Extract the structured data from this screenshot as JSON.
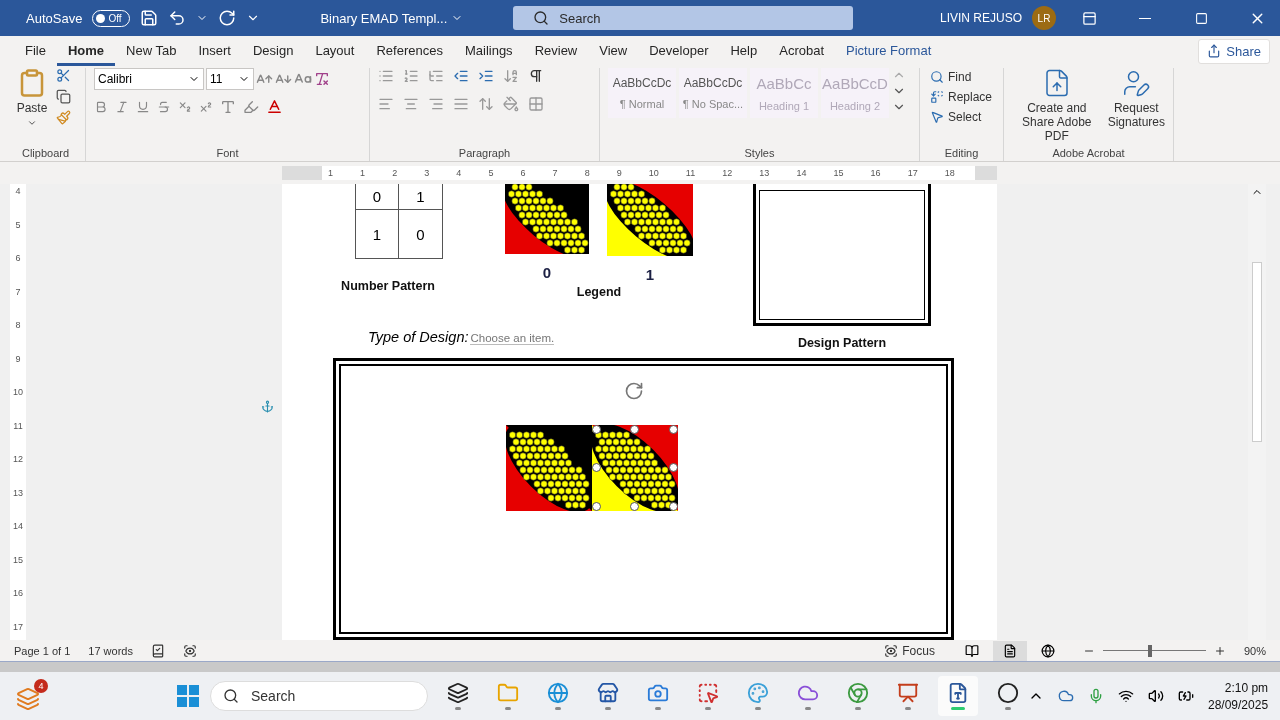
{
  "titlebar": {
    "autosave_label": "AutoSave",
    "autosave_state": "Off",
    "autosave_on": false,
    "document": "Binary EMAD Templ...",
    "search_placeholder": "Search",
    "user": "LIVIN REJUSO",
    "initials": "LR"
  },
  "menu_tabs": [
    {
      "label": "File",
      "selected": false,
      "kind": "normal"
    },
    {
      "label": "Home",
      "selected": true,
      "kind": "normal"
    },
    {
      "label": "New Tab",
      "selected": false,
      "kind": "normal"
    },
    {
      "label": "Insert",
      "selected": false,
      "kind": "normal"
    },
    {
      "label": "Design",
      "selected": false,
      "kind": "normal"
    },
    {
      "label": "Layout",
      "selected": false,
      "kind": "normal"
    },
    {
      "label": "References",
      "selected": false,
      "kind": "normal"
    },
    {
      "label": "Mailings",
      "selected": false,
      "kind": "normal"
    },
    {
      "label": "Review",
      "selected": false,
      "kind": "normal"
    },
    {
      "label": "View",
      "selected": false,
      "kind": "normal"
    },
    {
      "label": "Developer",
      "selected": false,
      "kind": "normal"
    },
    {
      "label": "Help",
      "selected": false,
      "kind": "normal"
    },
    {
      "label": "Acrobat",
      "selected": false,
      "kind": "normal"
    },
    {
      "label": "Picture Format",
      "selected": false,
      "kind": "contextual"
    }
  ],
  "share": "Share",
  "ribbon": {
    "paste": "Paste",
    "font_name": "Calibri",
    "font_size": "11",
    "styles": [
      {
        "sample": "AaBbCcDc",
        "label": "¶ Normal",
        "kind": "body"
      },
      {
        "sample": "AaBbCcDc",
        "label": "¶ No Spac...",
        "kind": "body"
      },
      {
        "sample": "AaBbCc",
        "label": "Heading 1",
        "kind": "heading"
      },
      {
        "sample": "AaBbCcD",
        "label": "Heading 2",
        "kind": "heading"
      }
    ],
    "editing": [
      {
        "label": "Find",
        "kind": "find"
      },
      {
        "label": "Replace",
        "kind": "replace"
      },
      {
        "label": "Select",
        "kind": "select"
      }
    ],
    "acrobat": [
      {
        "label": "Create and Share Adobe PDF",
        "kind": "pdf"
      },
      {
        "label": "Request Signatures",
        "kind": "sign"
      }
    ],
    "groups": [
      "Clipboard",
      "Font",
      "Paragraph",
      "Styles",
      "Editing",
      "Adobe Acrobat"
    ]
  },
  "ruler": {
    "horizontal": [
      "1",
      "1",
      "2",
      "3",
      "4",
      "5",
      "6",
      "7",
      "8",
      "9",
      "10",
      "11",
      "12",
      "13",
      "14",
      "15",
      "16",
      "17",
      "18"
    ],
    "vertical": [
      "4",
      "5",
      "6",
      "7",
      "8",
      "9",
      "10",
      "11",
      "12",
      "13",
      "14",
      "15",
      "16",
      "17"
    ]
  },
  "document": {
    "number_pattern": {
      "rows": [
        [
          "0",
          "1"
        ],
        [
          "1",
          "0"
        ]
      ],
      "label": "Number Pattern"
    },
    "legend": {
      "tiles": [
        {
          "kind": "zero",
          "label": "0"
        },
        {
          "kind": "one",
          "label": "1"
        }
      ],
      "label": "Legend"
    },
    "type_of_design": {
      "label": "Type of Design:",
      "placeholder": "Choose an item."
    },
    "design_pattern": {
      "label": "Design Pattern"
    },
    "canvas_tiles": [
      {
        "kind": "zero",
        "selected": false
      },
      {
        "kind": "one",
        "selected": true
      }
    ]
  },
  "status_bar": {
    "page": "Page 1 of 1",
    "words": "17 words",
    "focus": "Focus",
    "views": [
      {
        "kind": "read",
        "selected": false
      },
      {
        "kind": "print",
        "selected": true
      },
      {
        "kind": "web",
        "selected": false
      }
    ],
    "zoom_slider": {
      "level": 0.46
    },
    "zoom": "90%"
  },
  "taskbar": {
    "widget_badge": "4",
    "search_placeholder": "Search",
    "apps": [
      {
        "kind": "taskview",
        "selected": false
      },
      {
        "kind": "files",
        "selected": false
      },
      {
        "kind": "edge",
        "selected": false
      },
      {
        "kind": "store",
        "selected": false
      },
      {
        "kind": "camera",
        "selected": false
      },
      {
        "kind": "snip",
        "selected": false
      },
      {
        "kind": "paint",
        "selected": false
      },
      {
        "kind": "m365",
        "selected": false
      },
      {
        "kind": "chrome",
        "selected": false
      },
      {
        "kind": "powerpoint",
        "selected": false
      },
      {
        "kind": "word",
        "selected": true
      },
      {
        "kind": "obs",
        "selected": false
      }
    ],
    "time": "2:10 pm",
    "date": "28/09/2025"
  }
}
